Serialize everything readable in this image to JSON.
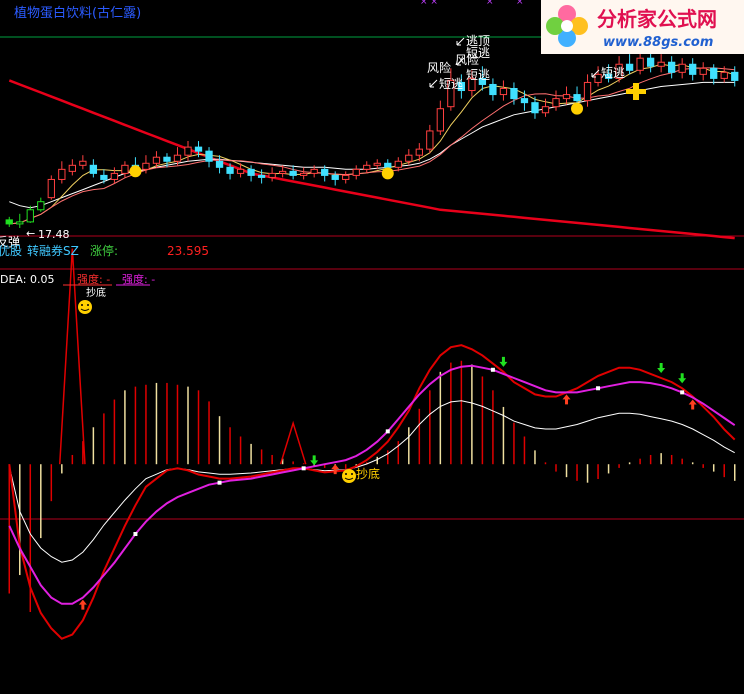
{
  "header": {
    "title": "植物蛋白饮料(古仁露)"
  },
  "logo": {
    "name": "分析家公式网",
    "url": "www.88gs.com"
  },
  "main_panel": {
    "low_label": "17.48",
    "info_row": {
      "tag1": "优股",
      "tag2": "转融券SZ",
      "limit_label": "涨停:",
      "limit_value": "23.595"
    },
    "left_cut_label": "反弹",
    "annotations": [
      {
        "text": "逃顶"
      },
      {
        "text": "短逃"
      },
      {
        "text": "风险"
      },
      {
        "text": "风险"
      },
      {
        "text": "短逃"
      },
      {
        "text": "短逃"
      },
      {
        "text": "短逃"
      }
    ]
  },
  "indicator_panel": {
    "dea_label": "DEA: 0.05",
    "strength_label_1": "强度: -",
    "strength_label_2": "强度: -",
    "bottom_label": "抄底",
    "top_label": "抄底"
  },
  "colors": {
    "background": "#000000",
    "title": "#2b5bff",
    "grid_red": "#b0001c",
    "green_line": "#00a040",
    "candle_up": "#ff4040",
    "candle_down": "#40e0ff",
    "ma_red": "#e8001a",
    "ma_white": "#ffffff",
    "ma_yellow": "#f0d060",
    "ma_pink": "#ff7070",
    "magenta": "#e020e0",
    "bar_red": "#e00000",
    "bar_yellow": "#f0e0a0",
    "info_cyan": "#40c8ff",
    "info_green": "#40d040",
    "limit_red": "#ff2020",
    "gold": "#ffd000"
  },
  "chart_data": [
    {
      "type": "candlestick",
      "title": "",
      "candles": [
        [
          17.52,
          17.48,
          17.55,
          17.45
        ],
        [
          17.48,
          17.5,
          17.58,
          17.44
        ],
        [
          17.5,
          17.62,
          17.66,
          17.49
        ],
        [
          17.62,
          17.7,
          17.74,
          17.6
        ],
        [
          17.74,
          17.92,
          17.96,
          17.72
        ],
        [
          17.92,
          18.02,
          18.1,
          17.88
        ],
        [
          18.0,
          18.06,
          18.12,
          17.96
        ],
        [
          18.06,
          18.1,
          18.16,
          18.02
        ],
        [
          18.06,
          17.98,
          18.12,
          17.94
        ],
        [
          17.96,
          17.92,
          18.02,
          17.88
        ],
        [
          17.92,
          17.98,
          18.04,
          17.88
        ],
        [
          17.98,
          18.06,
          18.1,
          17.94
        ],
        [
          18.06,
          18.02,
          18.14,
          17.98
        ],
        [
          18.02,
          18.08,
          18.16,
          17.98
        ],
        [
          18.08,
          18.14,
          18.2,
          18.04
        ],
        [
          18.14,
          18.1,
          18.18,
          18.04
        ],
        [
          18.1,
          18.16,
          18.24,
          18.06
        ],
        [
          18.16,
          18.24,
          18.3,
          18.1
        ],
        [
          18.24,
          18.2,
          18.3,
          18.14
        ],
        [
          18.2,
          18.1,
          18.24,
          18.04
        ],
        [
          18.1,
          18.04,
          18.16,
          17.98
        ],
        [
          18.04,
          17.98,
          18.08,
          17.92
        ],
        [
          17.98,
          18.02,
          18.08,
          17.94
        ],
        [
          18.02,
          17.96,
          18.06,
          17.9
        ],
        [
          17.96,
          17.94,
          18.02,
          17.88
        ],
        [
          17.94,
          17.98,
          18.04,
          17.9
        ],
        [
          17.98,
          18.0,
          18.06,
          17.94
        ],
        [
          18.0,
          17.96,
          18.06,
          17.92
        ],
        [
          17.96,
          17.98,
          18.04,
          17.92
        ],
        [
          17.98,
          18.02,
          18.06,
          17.94
        ],
        [
          18.02,
          17.96,
          18.06,
          17.9
        ],
        [
          17.96,
          17.92,
          18.0,
          17.86
        ],
        [
          17.92,
          17.96,
          18.0,
          17.88
        ],
        [
          17.96,
          18.02,
          18.06,
          17.92
        ],
        [
          18.02,
          18.06,
          18.1,
          17.98
        ],
        [
          18.06,
          18.08,
          18.12,
          18.02
        ],
        [
          18.08,
          18.04,
          18.12,
          18.0
        ],
        [
          18.04,
          18.1,
          18.14,
          18.0
        ],
        [
          18.1,
          18.16,
          18.22,
          18.06
        ],
        [
          18.16,
          18.22,
          18.28,
          18.1
        ],
        [
          18.22,
          18.4,
          18.46,
          18.18
        ],
        [
          18.4,
          18.62,
          18.7,
          18.36
        ],
        [
          18.64,
          18.9,
          19.02,
          18.6
        ],
        [
          18.88,
          18.8,
          18.96,
          18.72
        ],
        [
          18.8,
          18.92,
          19.0,
          18.74
        ],
        [
          18.92,
          18.86,
          19.04,
          18.8
        ],
        [
          18.86,
          18.76,
          18.92,
          18.7
        ],
        [
          18.76,
          18.82,
          18.9,
          18.7
        ],
        [
          18.82,
          18.72,
          18.88,
          18.66
        ],
        [
          18.72,
          18.68,
          18.8,
          18.6
        ],
        [
          18.68,
          18.58,
          18.74,
          18.52
        ],
        [
          18.58,
          18.64,
          18.72,
          18.54
        ],
        [
          18.64,
          18.72,
          18.8,
          18.6
        ],
        [
          18.72,
          18.76,
          18.84,
          18.66
        ],
        [
          18.76,
          18.7,
          18.84,
          18.64
        ],
        [
          18.7,
          18.88,
          18.96,
          18.64
        ],
        [
          18.88,
          18.96,
          19.04,
          18.84
        ],
        [
          18.96,
          18.92,
          19.06,
          18.88
        ],
        [
          18.92,
          19.06,
          19.14,
          18.88
        ],
        [
          19.06,
          19.0,
          19.16,
          18.96
        ],
        [
          19.0,
          19.12,
          19.2,
          18.96
        ],
        [
          19.12,
          19.04,
          19.18,
          18.98
        ],
        [
          19.04,
          19.08,
          19.16,
          18.98
        ],
        [
          19.08,
          18.98,
          19.14,
          18.92
        ],
        [
          18.98,
          19.06,
          19.12,
          18.92
        ],
        [
          19.06,
          18.96,
          19.12,
          18.9
        ],
        [
          18.96,
          19.02,
          19.08,
          18.9
        ],
        [
          19.02,
          18.92,
          19.06,
          18.86
        ],
        [
          18.92,
          18.98,
          19.04,
          18.88
        ],
        [
          18.98,
          18.9,
          19.04,
          18.84
        ]
      ],
      "ma_long": [
        18.9,
        18.86,
        18.82,
        18.78,
        18.74,
        18.7,
        18.66,
        18.62,
        18.58,
        18.54,
        18.5,
        18.46,
        18.42,
        18.38,
        18.34,
        18.3,
        18.26,
        18.22,
        18.18,
        18.14,
        18.1,
        18.06,
        18.02,
        17.98,
        17.96,
        17.94,
        17.92,
        17.9,
        17.88,
        17.86,
        17.84,
        17.82,
        17.8,
        17.78,
        17.76,
        17.74,
        17.72,
        17.7,
        17.68,
        17.66,
        17.64,
        17.62,
        17.61,
        17.6,
        17.59,
        17.58,
        17.57,
        17.56,
        17.55,
        17.54,
        17.53,
        17.52,
        17.51,
        17.5,
        17.49,
        17.48,
        17.47,
        17.46,
        17.45,
        17.44,
        17.43,
        17.42,
        17.41,
        17.4,
        17.39,
        17.38,
        17.37,
        17.36,
        17.35,
        17.34
      ],
      "ma_mid": [
        17.7,
        17.66,
        17.64,
        17.66,
        17.7,
        17.74,
        17.78,
        17.82,
        17.86,
        17.9,
        17.94,
        17.98,
        18.0,
        18.02,
        18.04,
        18.06,
        18.08,
        18.1,
        18.11,
        18.12,
        18.12,
        18.11,
        18.1,
        18.09,
        18.08,
        18.07,
        18.06,
        18.05,
        18.04,
        18.04,
        18.04,
        18.03,
        18.02,
        18.02,
        18.02,
        18.03,
        18.04,
        18.05,
        18.06,
        18.08,
        18.12,
        18.18,
        18.26,
        18.32,
        18.38,
        18.44,
        18.48,
        18.52,
        18.56,
        18.58,
        18.6,
        18.62,
        18.64,
        18.66,
        18.68,
        18.7,
        18.72,
        18.74,
        18.76,
        18.78,
        18.8,
        18.82,
        18.84,
        18.85,
        18.86,
        18.87,
        18.88,
        18.88,
        18.88,
        18.88
      ],
      "ylim": [
        17.4,
        19.3
      ]
    },
    {
      "type": "macd",
      "title": "",
      "dea_value": 0.05,
      "bars": [
        -1.4,
        -1.2,
        -1.6,
        -0.8,
        -0.4,
        -0.1,
        0.1,
        0.25,
        0.4,
        0.55,
        0.7,
        0.8,
        0.84,
        0.86,
        0.88,
        0.88,
        0.86,
        0.84,
        0.8,
        0.68,
        0.52,
        0.4,
        0.3,
        0.22,
        0.16,
        0.1,
        0.06,
        0.03,
        0.01,
        -0.02,
        -0.04,
        -0.06,
        -0.05,
        -0.03,
        0.02,
        0.08,
        0.15,
        0.25,
        0.4,
        0.6,
        0.8,
        1.0,
        1.1,
        1.12,
        1.08,
        0.95,
        0.8,
        0.62,
        0.45,
        0.3,
        0.15,
        0.02,
        -0.08,
        -0.14,
        -0.18,
        -0.2,
        -0.16,
        -0.1,
        -0.04,
        0.02,
        0.06,
        0.1,
        0.12,
        0.1,
        0.06,
        0.02,
        -0.04,
        -0.08,
        -0.14,
        -0.18
      ],
      "dif": [
        0.0,
        -0.8,
        -1.2,
        -1.45,
        -1.6,
        -1.7,
        -1.66,
        -1.52,
        -1.3,
        -1.04,
        -0.82,
        -0.6,
        -0.4,
        -0.22,
        -0.14,
        -0.06,
        -0.04,
        -0.06,
        -0.1,
        -0.12,
        -0.14,
        -0.14,
        -0.13,
        -0.12,
        -0.1,
        -0.08,
        -0.06,
        -0.04,
        -0.04,
        -0.06,
        -0.08,
        -0.07,
        -0.06,
        -0.02,
        0.04,
        0.12,
        0.22,
        0.36,
        0.52,
        0.74,
        0.92,
        1.06,
        1.14,
        1.16,
        1.12,
        1.06,
        0.98,
        0.9,
        0.8,
        0.74,
        0.68,
        0.66,
        0.66,
        0.7,
        0.74,
        0.8,
        0.86,
        0.9,
        0.94,
        0.94,
        0.92,
        0.88,
        0.84,
        0.8,
        0.74,
        0.66,
        0.56,
        0.46,
        0.34,
        0.24
      ],
      "dea": [
        -0.6,
        -0.82,
        -1.0,
        -1.18,
        -1.3,
        -1.36,
        -1.36,
        -1.3,
        -1.2,
        -1.08,
        -0.96,
        -0.82,
        -0.68,
        -0.56,
        -0.46,
        -0.38,
        -0.32,
        -0.28,
        -0.24,
        -0.2,
        -0.18,
        -0.16,
        -0.15,
        -0.14,
        -0.12,
        -0.1,
        -0.08,
        -0.06,
        -0.04,
        -0.02,
        0.0,
        0.02,
        0.04,
        0.08,
        0.14,
        0.22,
        0.32,
        0.44,
        0.56,
        0.68,
        0.78,
        0.86,
        0.92,
        0.95,
        0.96,
        0.94,
        0.92,
        0.88,
        0.84,
        0.8,
        0.76,
        0.72,
        0.7,
        0.7,
        0.7,
        0.72,
        0.74,
        0.76,
        0.78,
        0.8,
        0.8,
        0.79,
        0.77,
        0.74,
        0.7,
        0.65,
        0.59,
        0.52,
        0.45,
        0.38
      ],
      "ylim": [
        -2.2,
        1.6
      ],
      "top_spikes": [
        {
          "index": 6,
          "value": 2.1
        },
        {
          "index": 27,
          "value": 0.4
        }
      ]
    }
  ]
}
